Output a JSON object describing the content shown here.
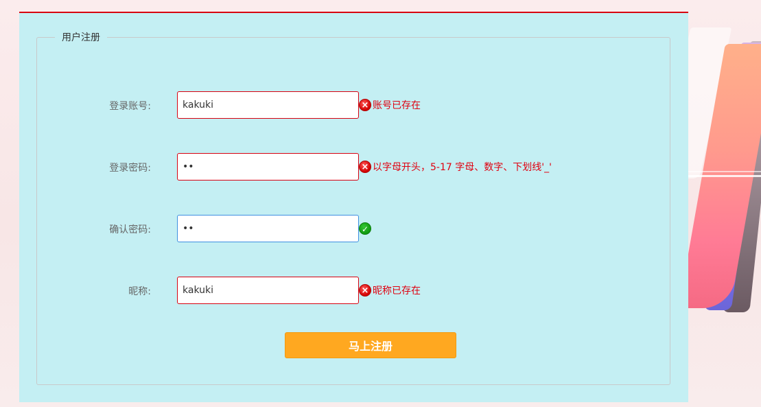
{
  "form": {
    "legend": "用户注册",
    "fields": [
      {
        "label": "登录账号:",
        "value": "kakuki",
        "status": "error",
        "message": "账号已存在"
      },
      {
        "label": "登录密码:",
        "value": "••",
        "status": "error",
        "message": "以字母开头，5-17 字母、数字、下划线'_'"
      },
      {
        "label": "确认密码:",
        "value": "••",
        "status": "ok",
        "message": ""
      },
      {
        "label": "昵称:",
        "value": "kakuki",
        "status": "error",
        "message": "昵称已存在"
      }
    ],
    "submit_label": "马上注册"
  },
  "icons": {
    "error": "error-circle-icon",
    "ok": "check-circle-icon"
  },
  "colors": {
    "accent_red": "#d7000f",
    "panel_bg": "#c4eff3",
    "button_bg": "#ffa820",
    "error_text": "#e0000f"
  }
}
